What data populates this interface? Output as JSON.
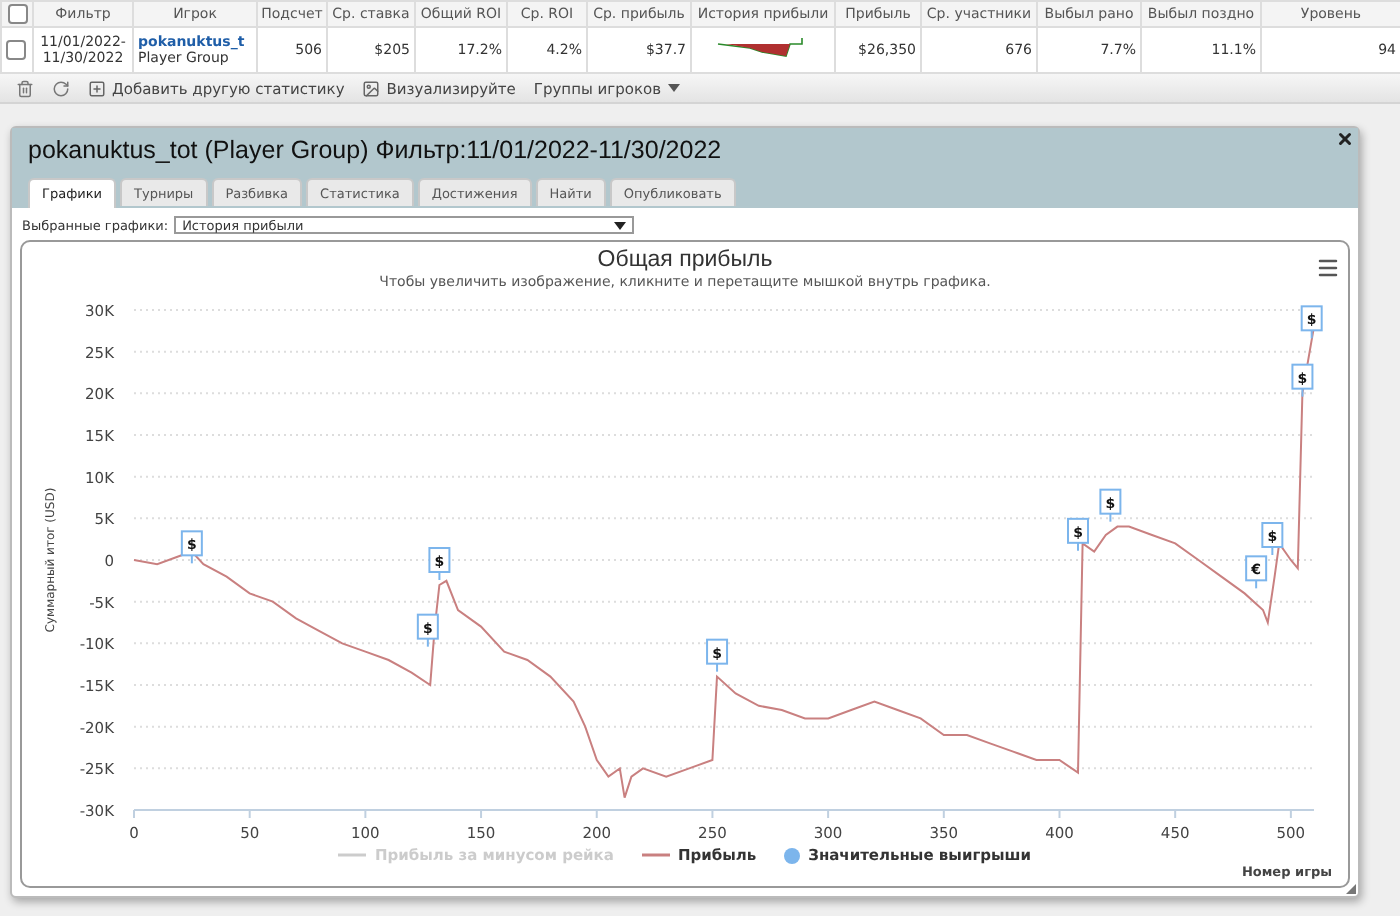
{
  "stats_table": {
    "all_checked": false,
    "columns": [
      "Фильтр",
      "Игрок",
      "Подсчет",
      "Ср. ставка",
      "Общий ROI",
      "Ср. ROI",
      "Ср. прибыль",
      "История прибыли",
      "Прибыль",
      "Ср. участники",
      "Выбыл рано",
      "Выбыл поздно",
      "Уровень"
    ],
    "rows": [
      {
        "checked": false,
        "cells": [
          "11/01/2022-\n11/30/2022",
          {
            "link": "pokanuktus_t",
            "sub": "Player Group"
          },
          "506",
          "$205",
          "17.2%",
          "4.2%",
          "$37.7",
          null,
          "$26,350",
          "676",
          "7.7%",
          "11.1%",
          "94"
        ]
      }
    ]
  },
  "toolbar": {
    "items": [
      {
        "kind": "delete"
      },
      {
        "kind": "refresh"
      },
      {
        "kind": "link",
        "label": "Добавить другую статистику"
      },
      {
        "kind": "link",
        "label": "Визуализируйте"
      },
      {
        "kind": "menu",
        "label": "Группы игроков"
      }
    ]
  },
  "panel": {
    "title": "pokanuktus_tot (Player Group) Фильтр:11/01/2022-11/30/2022",
    "tabs": [
      {
        "label": "Графики",
        "selected": true
      },
      {
        "label": "Турниры",
        "selected": false
      },
      {
        "label": "Разбивка",
        "selected": false
      },
      {
        "label": "Статистика",
        "selected": false
      },
      {
        "label": "Достижения",
        "selected": false
      },
      {
        "label": "Найти",
        "selected": false
      },
      {
        "label": "Опубликовать",
        "selected": false
      }
    ],
    "graph_select": {
      "label": "Выбранные графики:",
      "value": "История прибыли"
    },
    "chart": {
      "title": "Общая прибыль",
      "subtitle": "Чтобы увеличить изображение, кликните и перетащите мышкой внутрь графика.",
      "legend": [
        {
          "name": "Прибыль за минусом рейка",
          "kind": "line",
          "enabled": false,
          "color": "#cccccc"
        },
        {
          "name": "Значительные выигрыши",
          "kind": "dot",
          "enabled": true,
          "color": "#7cb5ec"
        }
      ],
      "chart_data": {
        "type": "line",
        "grid": true,
        "xlabel": "Номер игры",
        "ylabel": "Суммарный итог (USD)",
        "xlim": [
          0,
          510
        ],
        "ylim": [
          -30000,
          30000
        ],
        "xticks": [
          0,
          50,
          100,
          150,
          200,
          250,
          300,
          350,
          400,
          450,
          500
        ],
        "yticks": [
          {
            "value": -30000,
            "label": "-30K"
          },
          {
            "value": -25000,
            "label": "-25K"
          },
          {
            "value": -20000,
            "label": "-20K"
          },
          {
            "value": -15000,
            "label": "-15K"
          },
          {
            "value": -10000,
            "label": "-10K"
          },
          {
            "value": -5000,
            "label": "-5K"
          },
          {
            "value": 0,
            "label": "0"
          },
          {
            "value": 5000,
            "label": "5K"
          },
          {
            "value": 10000,
            "label": "10K"
          },
          {
            "value": 15000,
            "label": "15K"
          },
          {
            "value": 20000,
            "label": "20K"
          },
          {
            "value": 25000,
            "label": "25K"
          },
          {
            "value": 30000,
            "label": "30K"
          }
        ],
        "x": [
          0,
          10,
          20,
          25,
          30,
          40,
          50,
          60,
          70,
          80,
          90,
          100,
          110,
          120,
          128,
          130,
          132,
          135,
          140,
          150,
          160,
          170,
          180,
          190,
          195,
          200,
          205,
          210,
          212,
          215,
          220,
          230,
          240,
          250,
          252,
          260,
          270,
          280,
          290,
          300,
          310,
          320,
          330,
          340,
          350,
          360,
          370,
          380,
          390,
          400,
          408,
          410,
          415,
          420,
          425,
          430,
          440,
          450,
          460,
          470,
          480,
          488,
          490,
          493,
          495,
          500,
          503,
          505,
          510
        ],
        "series": [
          {
            "name": "Прибыль",
            "color": "#c98080",
            "values": [
              0,
              -500,
              500,
              1000,
              -500,
              -2000,
              -4000,
              -5000,
              -7000,
              -8500,
              -10000,
              -11000,
              -12000,
              -13500,
              -15000,
              -8000,
              -3000,
              -2500,
              -6000,
              -8000,
              -11000,
              -12000,
              -14000,
              -17000,
              -20000,
              -24000,
              -26000,
              -25000,
              -28500,
              -26000,
              -25000,
              -26000,
              -25000,
              -24000,
              -14000,
              -16000,
              -17500,
              -18000,
              -19000,
              -19000,
              -18000,
              -17000,
              -18000,
              -19000,
              -21000,
              -21000,
              -22000,
              -23000,
              -24000,
              -24000,
              -25500,
              2000,
              1000,
              3000,
              4000,
              4000,
              3000,
              2000,
              0,
              -2000,
              -4000,
              -6000,
              -7500,
              -2000,
              2000,
              0,
              -1000,
              20000,
              28000
            ]
          }
        ],
        "annotations": [
          {
            "x": 25,
            "y": 2000,
            "text": "$"
          },
          {
            "x": 127,
            "y": -8000,
            "text": "$"
          },
          {
            "x": 132,
            "y": 0,
            "text": "$"
          },
          {
            "x": 252,
            "y": -11000,
            "text": "$"
          },
          {
            "x": 408,
            "y": 3500,
            "text": "$"
          },
          {
            "x": 422,
            "y": 7000,
            "text": "$"
          },
          {
            "x": 485,
            "y": -1000,
            "text": "€"
          },
          {
            "x": 492,
            "y": 3000,
            "text": "$"
          },
          {
            "x": 505,
            "y": 22000,
            "text": "$"
          },
          {
            "x": 509,
            "y": 29000,
            "text": "$"
          }
        ]
      }
    }
  }
}
